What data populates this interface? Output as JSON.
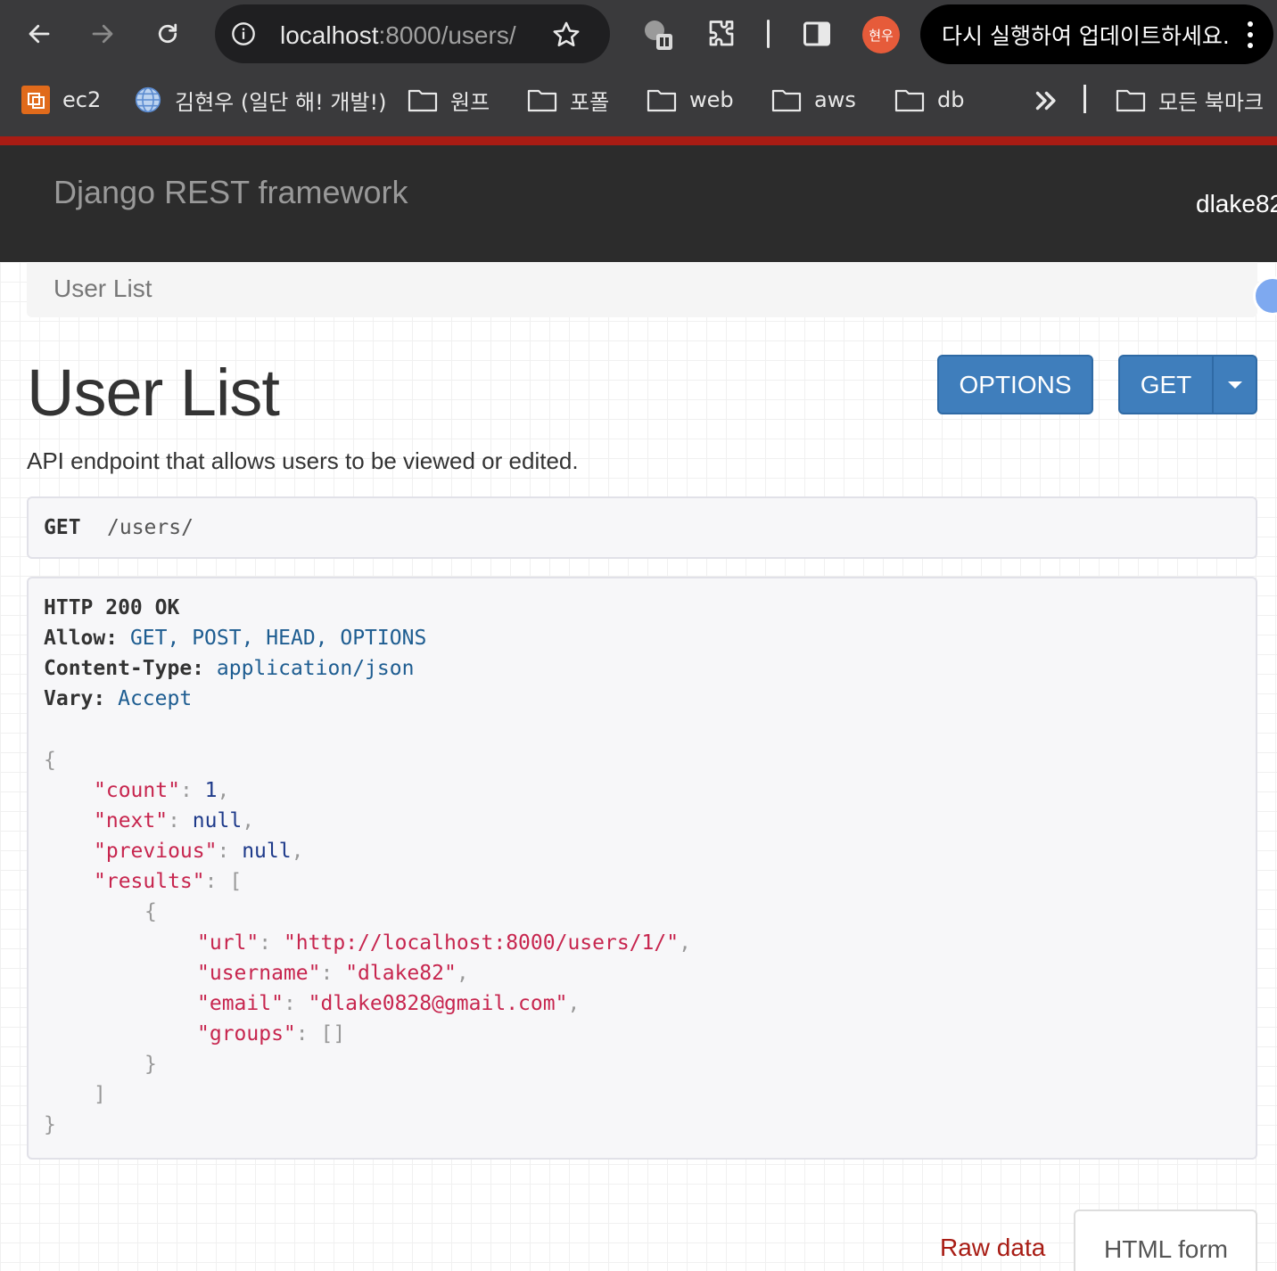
{
  "browser": {
    "url_host": "localhost",
    "url_rest": ":8000/users/",
    "profile_initials": "현우",
    "update_label": "다시 실행하여 업데이트하세요.",
    "bookmarks": [
      {
        "label": "ec2",
        "icon": "aws-ec2-icon"
      },
      {
        "label": "김현우 (일단 해! 개발!)",
        "icon": "globe-icon"
      },
      {
        "label": "원프",
        "icon": "folder-icon"
      },
      {
        "label": "포폴",
        "icon": "folder-icon"
      },
      {
        "label": "web",
        "icon": "folder-icon"
      },
      {
        "label": "aws",
        "icon": "folder-icon"
      },
      {
        "label": "db",
        "icon": "folder-icon"
      }
    ],
    "all_bookmarks_label": "모든 북마크"
  },
  "navbar": {
    "brand": "Django REST framework",
    "user": "dlake82"
  },
  "breadcrumb": {
    "current": "User List"
  },
  "page": {
    "title": "User List",
    "description": "API endpoint that allows users to be viewed or edited.",
    "options_label": "OPTIONS",
    "get_label": "GET"
  },
  "request": {
    "method": "GET",
    "path": "/users/"
  },
  "response": {
    "status": "HTTP 200 OK",
    "allow_key": "Allow:",
    "allow_val": "GET, POST, HEAD, OPTIONS",
    "ctype_key": "Content-Type:",
    "ctype_val": "application/json",
    "vary_key": "Vary:",
    "vary_val": "Accept",
    "count": "1",
    "next": "null",
    "previous": "null",
    "result_url": "\"http://localhost:8000/users/1/\"",
    "result_username": "\"dlake82\"",
    "result_email": "\"dlake0828@gmail.com\"",
    "result_groups": "[]"
  },
  "tabs": {
    "raw": "Raw data",
    "html": "HTML form"
  },
  "colors": {
    "accent_red": "#a81c14",
    "button_blue": "#3f7ebc",
    "navbar": "#2c2c2c"
  }
}
